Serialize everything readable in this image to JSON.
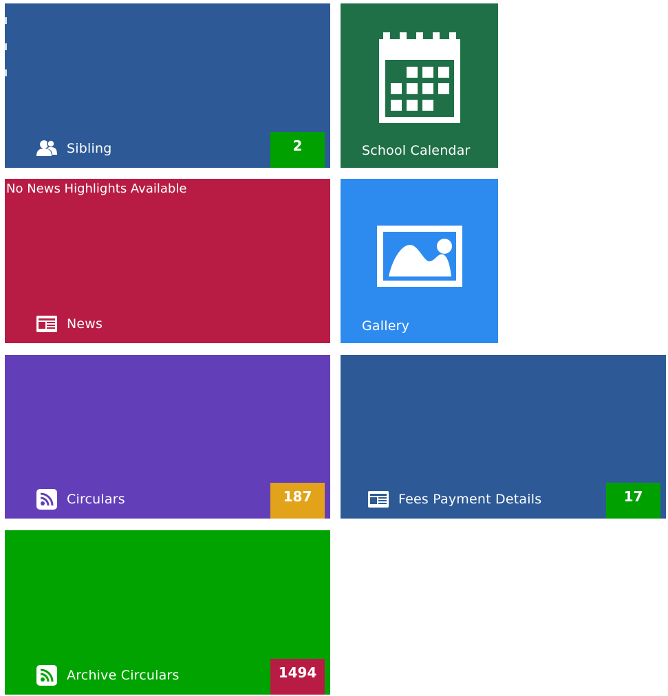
{
  "tiles": {
    "sibling": {
      "label": "Sibling",
      "badge": "2",
      "color": "#2d5a96",
      "badge_color": "#00a000",
      "icon": "users-icon"
    },
    "calendar": {
      "label": "School Calendar",
      "color": "#1f7047",
      "icon": "calendar-icon"
    },
    "news": {
      "label": "News",
      "headline": "No News Highlights Available",
      "color": "#b81c45",
      "icon": "newspaper-icon"
    },
    "gallery": {
      "label": "Gallery",
      "color": "#2d8bef",
      "icon": "picture-icon"
    },
    "circulars": {
      "label": "Circulars",
      "badge": "187",
      "color": "#623fb9",
      "badge_color": "#e2a31b",
      "icon": "rss-icon"
    },
    "fees": {
      "label": "Fees Payment Details",
      "badge": "17",
      "color": "#2d5a96",
      "badge_color": "#00a000",
      "icon": "newspaper-icon"
    },
    "archive": {
      "label": "Archive Circulars",
      "badge": "1494",
      "color": "#00a300",
      "badge_color": "#b81c45",
      "icon": "rss-icon"
    }
  }
}
